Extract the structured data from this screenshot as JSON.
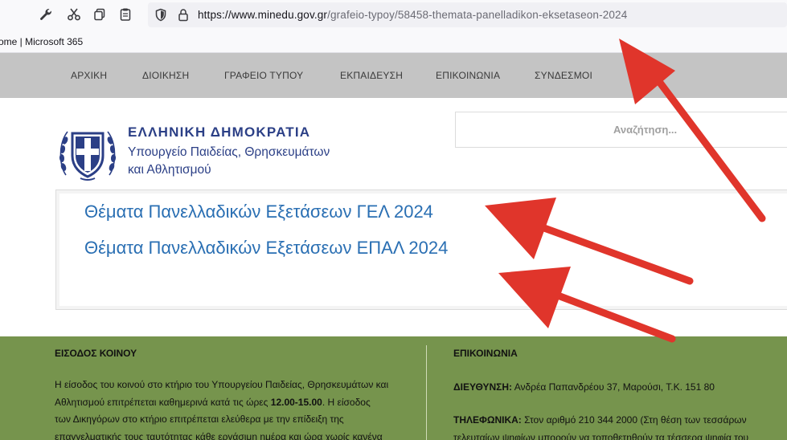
{
  "browser": {
    "url_host": "https://www.minedu.gov.gr",
    "url_path": "/grafeio-typoy/58458-themata-panelladikon-eksetaseon-2024",
    "bookmark_label": "ome | Microsoft 365"
  },
  "nav": {
    "items": [
      "ΑΡΧΙΚΗ",
      "ΔΙΟΙΚΗΣΗ",
      "ΓΡΑΦΕΙΟ ΤΥΠΟΥ",
      "ΕΚΠΑΙΔΕΥΣΗ",
      "ΕΠΙΚΟΙΝΩΝΙΑ",
      "ΣΥΝΔΕΣΜΟΙ"
    ]
  },
  "header": {
    "title": "ΕΛΛΗΝΙΚΗ ΔΗΜΟΚΡΑΤΙΑ",
    "subtitle_line1": "Υπουργείο Παιδείας, Θρησκευμάτων",
    "subtitle_line2": "και Αθλητισμού",
    "search_placeholder": "Αναζήτηση..."
  },
  "content": {
    "links": [
      "Θέματα Πανελλαδικών Εξετάσεων ΓΕΛ 2024",
      "Θέματα Πανελλαδικών Εξετάσεων ΕΠΑΛ 2024"
    ]
  },
  "footer": {
    "left_heading": "ΕΙΣΟΔΟΣ ΚΟΙΝΟΥ",
    "left_line1": "Η είσοδος του κοινού στο κτήριο του Υπουργείου Παιδείας, Θρησκευμάτων και",
    "left_line2_pre": "Αθλητισμού επιτρέπεται καθημερινά κατά τις ώρες ",
    "left_line2_bold": "12.00-15.00",
    "left_line2_post": ". Η είσοδος",
    "left_line3": "των Δικηγόρων στο κτήριο επιτρέπεται ελεύθερα με την επίδειξη της",
    "left_line4": "επαγγελματικής τους ταυτότητας κάθε εργάσιμη ημέρα και ώρα χωρίς κανένα",
    "right_heading": "ΕΠΙΚΟΙΝΩΝΙΑ",
    "address_label": "ΔΙΕΥΘΥΝΣΗ:",
    "address_value": " Ανδρέα Παπανδρέου 37, Μαρούσι, Τ.Κ. 151 80",
    "phone_label": "ΤΗΛΕΦΩΝΙΚΑ:",
    "phone_value": " Στον αριθμό 210 344 2000 (Στη θέση των τεσσάρων",
    "phone_line2": "τελευταίων ψηφίων μπορούν να τοποθετηθούν τα τέσσερα ψηφία του"
  },
  "colors": {
    "nav_bg": "#c4c4c4",
    "link": "#2a6fb3",
    "org_blue": "#2b3f86",
    "footer_bg": "#76944d",
    "arrow": "#e0352b"
  },
  "icons": [
    "wrench-icon",
    "scissors-icon",
    "copy-icon",
    "clipboard-icon",
    "shield-icon",
    "lock-icon",
    "greek-emblem-icon"
  ]
}
